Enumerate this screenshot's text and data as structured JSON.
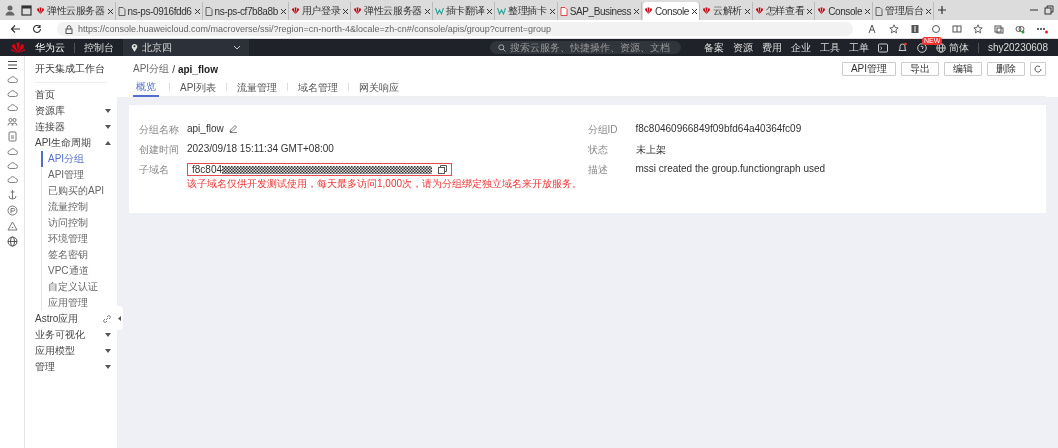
{
  "browser": {
    "tabs": [
      {
        "label": "弹性云服务器",
        "kind": "brand",
        "selected": false
      },
      {
        "label": "ns-ps-0916fdd6",
        "kind": "doc",
        "selected": false
      },
      {
        "label": "ns-ps-cf7b8a8b",
        "kind": "doc",
        "selected": false
      },
      {
        "label": "用户登录",
        "kind": "brand",
        "selected": false
      },
      {
        "label": "弹性云服务器",
        "kind": "brand",
        "selected": false
      },
      {
        "label": "插卡翻译",
        "kind": "w",
        "selected": false
      },
      {
        "label": "整理插卡",
        "kind": "w",
        "selected": false
      },
      {
        "label": "SAP_Business",
        "kind": "pdf",
        "selected": false
      },
      {
        "label": "Console",
        "kind": "brand",
        "selected": true
      },
      {
        "label": "云解析",
        "kind": "brand",
        "selected": false
      },
      {
        "label": "怎样查看",
        "kind": "brand",
        "selected": false
      },
      {
        "label": "Console",
        "kind": "brand",
        "selected": false
      },
      {
        "label": "管理后台",
        "kind": "doc",
        "selected": false
      }
    ],
    "address": "https://console.huaweicloud.com/macroverse/ssi/?region=cn-north-4&locale=zh-cn#/console/apis/group?current=group"
  },
  "topnav": {
    "brand": "华为云",
    "console": "控制台",
    "region": "北京四",
    "search_placeholder": "搜索云服务、快捷操作、资源、文档",
    "links": [
      "备案",
      "资源",
      "费用",
      "企业",
      "工具",
      "工单"
    ],
    "new_badge": "NEW",
    "language": "简体",
    "user": "shy20230608"
  },
  "sidebar": {
    "title": "开天集成工作台",
    "items": [
      {
        "label": "首页",
        "kind": "page"
      },
      {
        "label": "资源库",
        "kind": "group",
        "expanded": false
      },
      {
        "label": "连接器",
        "kind": "group",
        "expanded": false
      },
      {
        "label": "API生命周期",
        "kind": "group",
        "expanded": true,
        "children": [
          {
            "label": "API分组",
            "selected": true
          },
          {
            "label": "API管理",
            "selected": false
          },
          {
            "label": "已购买的API",
            "selected": false
          },
          {
            "label": "流量控制",
            "selected": false
          },
          {
            "label": "访问控制",
            "selected": false
          },
          {
            "label": "环境管理",
            "selected": false
          },
          {
            "label": "签名密钥",
            "selected": false
          },
          {
            "label": "VPC通道",
            "selected": false
          },
          {
            "label": "自定义认证",
            "selected": false
          },
          {
            "label": "应用管理",
            "selected": false
          }
        ]
      },
      {
        "label": "Astro应用",
        "kind": "link"
      },
      {
        "label": "业务可视化",
        "kind": "group",
        "expanded": false
      },
      {
        "label": "应用模型",
        "kind": "group",
        "expanded": false
      },
      {
        "label": "管理",
        "kind": "group",
        "expanded": false
      }
    ]
  },
  "breadcrumb": {
    "parent": "API分组",
    "separator": "/",
    "current": "api_flow"
  },
  "actions": [
    "API管理",
    "导出",
    "编辑",
    "删除"
  ],
  "tabs": [
    {
      "label": "概览",
      "selected": true
    },
    {
      "label": "API列表",
      "selected": false
    },
    {
      "label": "流量管理",
      "selected": false
    },
    {
      "label": "域名管理",
      "selected": false
    },
    {
      "label": "网关响应",
      "selected": false
    }
  ],
  "details": {
    "left": [
      {
        "label": "分组名称",
        "value": "api_flow",
        "kind": "editable"
      },
      {
        "label": "创建时间",
        "value": "2023/09/18 15:11:34 GMT+08:00",
        "kind": "text"
      },
      {
        "label": "子域名",
        "value": "f8c804",
        "kind": "masked",
        "error": "该子域名仅供开发测试使用，每天最多访问1,000次，请为分组绑定独立域名来开放服务。"
      }
    ],
    "right": [
      {
        "label": "分组ID",
        "value": "f8c80460966849f09bfd64a40364fc09"
      },
      {
        "label": "状态",
        "value": "未上架"
      },
      {
        "label": "描述",
        "value": "mssi created the group.functiongraph used"
      }
    ]
  }
}
